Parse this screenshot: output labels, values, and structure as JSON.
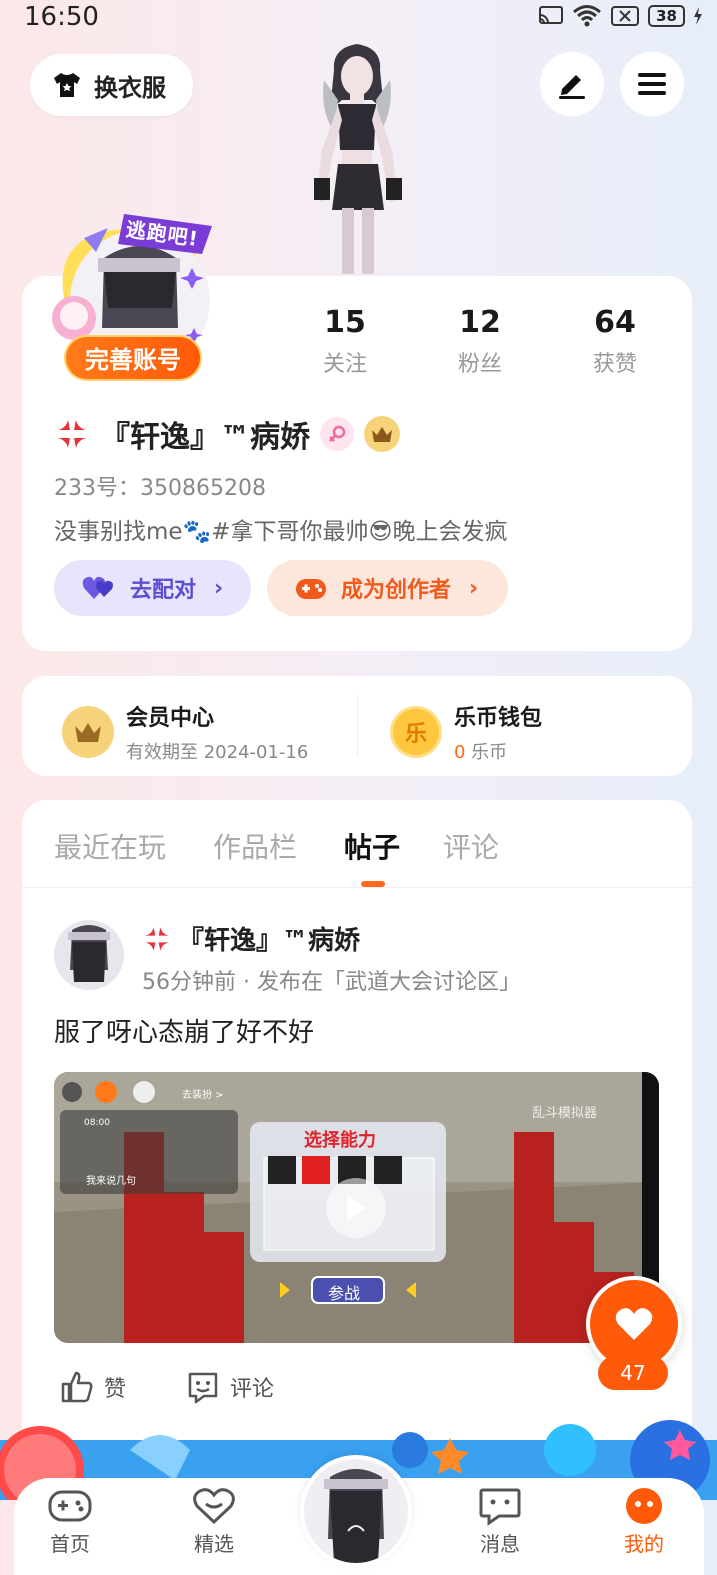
{
  "status_bar": {
    "time": "16:50",
    "battery": "38"
  },
  "header": {
    "outfit_label": "换衣服"
  },
  "profile": {
    "stats": [
      {
        "num": "15",
        "label": "关注"
      },
      {
        "num": "12",
        "label": "粉丝"
      },
      {
        "num": "64",
        "label": "获赞"
      }
    ],
    "avatar_badge_text": "逃跑吧!",
    "complete_account": "完善账号",
    "username": "『轩逸』™病娇",
    "id_line": "233号：350865208",
    "bio": "没事别找me🐾#拿下哥你最帅😎晚上会发疯",
    "match_label": "去配对",
    "creator_label": "成为创作者"
  },
  "member": {
    "vip_title": "会员中心",
    "vip_sub": "有效期至 2024-01-16",
    "wallet_title": "乐币钱包",
    "wallet_amount": "0",
    "wallet_unit": " 乐币",
    "wallet_icon_char": "乐"
  },
  "tabs": [
    {
      "label": "最近在玩"
    },
    {
      "label": "作品栏"
    },
    {
      "label": "帖子"
    },
    {
      "label": "评论"
    }
  ],
  "post": {
    "author": "『轩逸』™病娇",
    "meta": "56分钟前 · 发布在「武道大会讨论区」",
    "text": "服了呀心态崩了好不好",
    "video": {
      "choose_title": "选择能力",
      "join_label": "参战",
      "watermark": "乱斗模拟器",
      "chat_input": "我来说几句",
      "dress_label": "去装扮 >",
      "timer": "08:00"
    },
    "like_label": "赞",
    "comment_label": "评论"
  },
  "fab": {
    "count": "47"
  },
  "nav": {
    "home": "首页",
    "featured": "精选",
    "messages": "消息",
    "mine": "我的"
  },
  "colors": {
    "accent": "#ff5a0a",
    "purple": "#5a4ed1"
  }
}
